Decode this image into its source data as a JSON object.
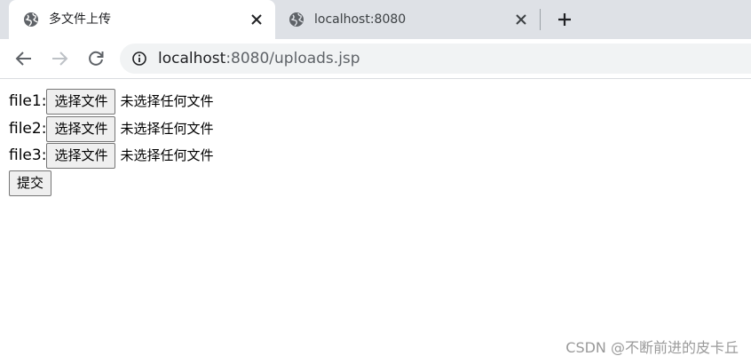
{
  "tabs": [
    {
      "title": "多文件上传",
      "icon": "globe-icon",
      "active": true
    },
    {
      "title": "localhost:8080",
      "icon": "globe-icon",
      "active": false
    }
  ],
  "toolbar": {
    "url_host": "localhost",
    "url_rest": ":8080/uploads.jsp"
  },
  "form": {
    "rows": [
      {
        "label": "file1:",
        "button": "选择文件",
        "status": "未选择任何文件"
      },
      {
        "label": "file2:",
        "button": "选择文件",
        "status": "未选择任何文件"
      },
      {
        "label": "file3:",
        "button": "选择文件",
        "status": "未选择任何文件"
      }
    ],
    "submit_label": "提交"
  },
  "watermark": "CSDN @不断前进的皮卡丘",
  "colors": {
    "tabstrip_bg": "#dee1e6",
    "omnibox_bg": "#f1f3f4",
    "button_bg": "#efefef"
  }
}
